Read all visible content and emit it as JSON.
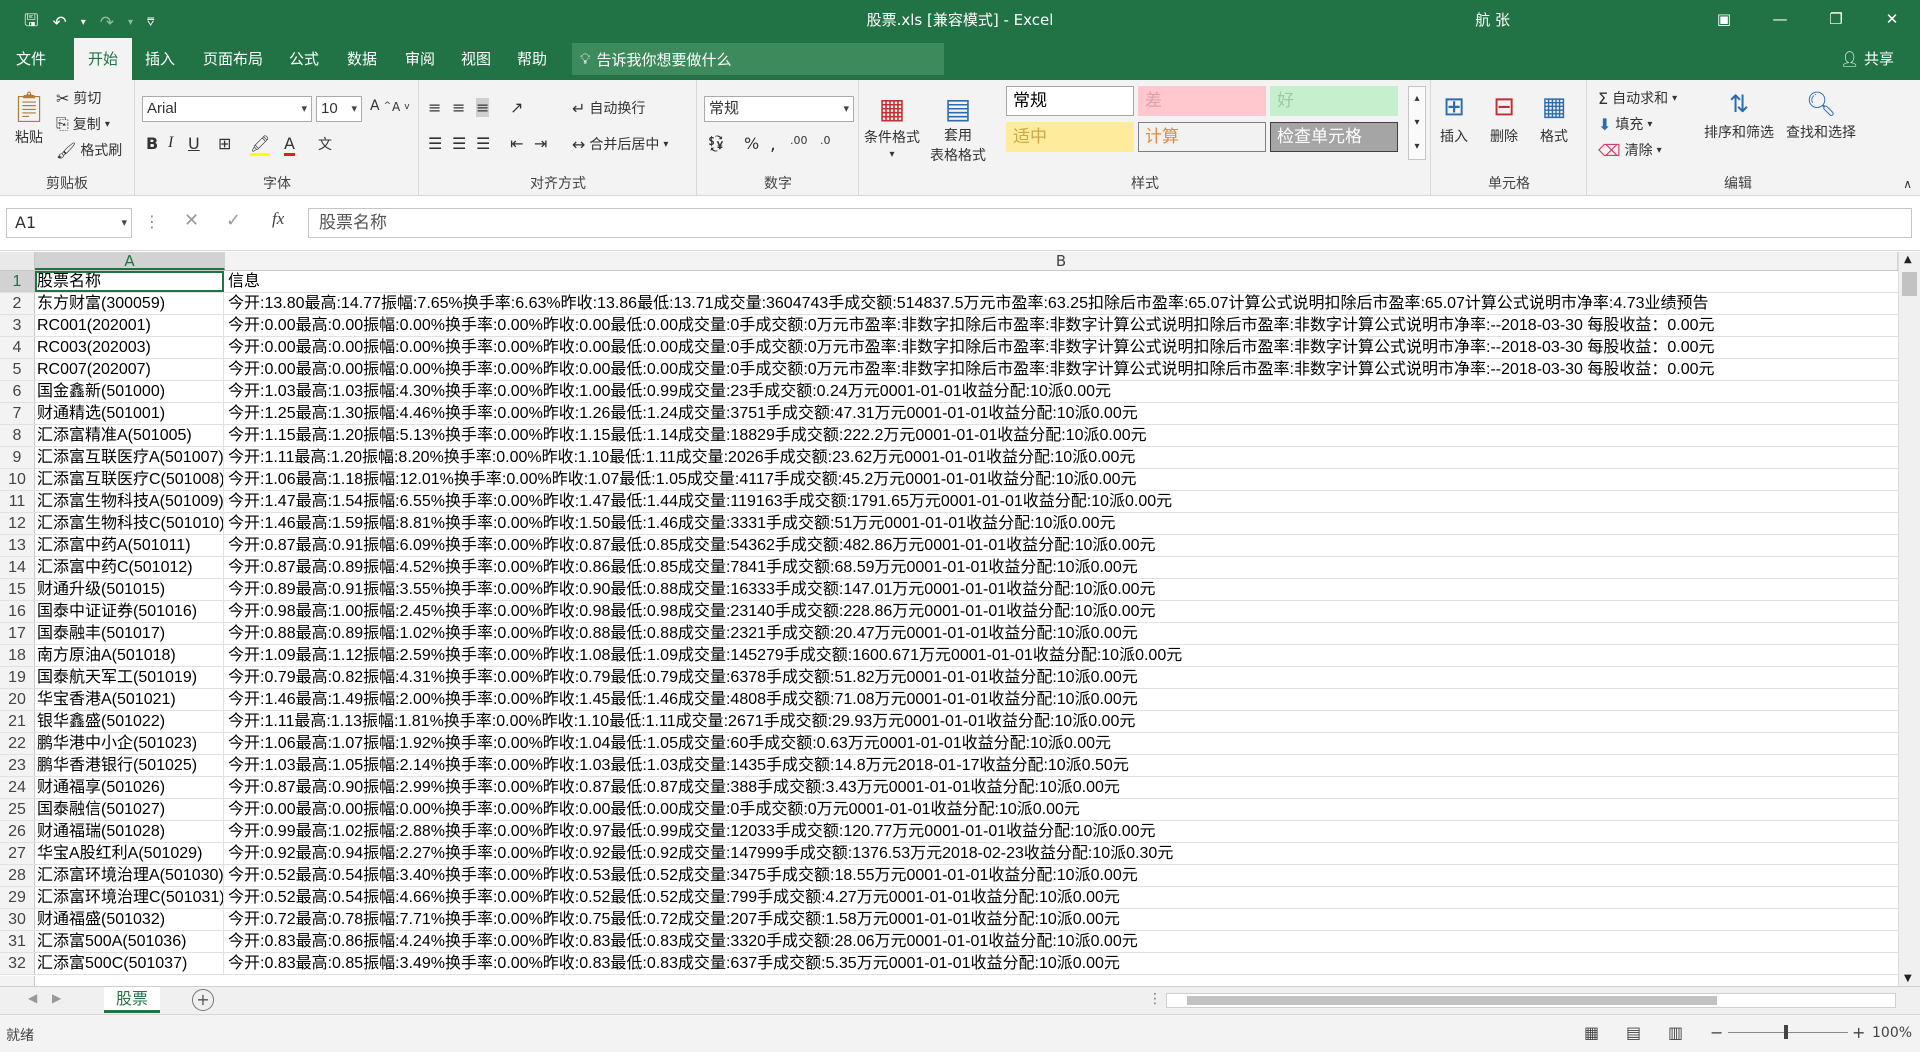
{
  "window": {
    "title": "股票.xls  [兼容模式]  -  Excel",
    "user": "航 张"
  },
  "menu": {
    "tabs": [
      "文件",
      "开始",
      "插入",
      "页面布局",
      "公式",
      "数据",
      "审阅",
      "视图",
      "帮助"
    ],
    "active_tab": "开始",
    "tell_me": "告诉我你想要做什么",
    "share": "共享"
  },
  "ribbon": {
    "clipboard": {
      "paste": "粘贴",
      "cut": "剪切",
      "copy": "复制",
      "format_painter": "格式刷",
      "label": "剪贴板"
    },
    "font": {
      "name": "Arial",
      "size": "10",
      "label": "字体"
    },
    "alignment": {
      "wrap_text": "自动换行",
      "merge_center": "合并后居中",
      "label": "对齐方式"
    },
    "number": {
      "format": "常规",
      "label": "数字"
    },
    "styles": {
      "conditional_formatting": "条件格式",
      "format_as_table_1": "套用",
      "format_as_table_2": "表格格式",
      "cells": [
        {
          "label": "常规",
          "bg": "#ffffff",
          "fg": "#000000",
          "border": "#a6a6a6"
        },
        {
          "label": "差",
          "bg": "#ffc7ce",
          "fg": "#e0a0a8",
          "border": "#ffc7ce"
        },
        {
          "label": "好",
          "bg": "#c6efce",
          "fg": "#9ccaa4",
          "border": "#c6efce"
        },
        {
          "label": "适中",
          "bg": "#ffeb9c",
          "fg": "#c9a84a",
          "border": "#ffeb9c"
        },
        {
          "label": "计算",
          "bg": "#f2f2f2",
          "fg": "#e08a3c",
          "border": "#7f7f7f"
        },
        {
          "label": "检查单元格",
          "bg": "#a5a5a5",
          "fg": "#ffffff",
          "border": "#3f3f3f"
        }
      ],
      "label": "样式"
    },
    "cells_group": {
      "insert": "插入",
      "delete": "删除",
      "format": "格式",
      "label": "单元格"
    },
    "editing": {
      "autosum": "自动求和",
      "fill": "填充",
      "clear": "清除",
      "sort_filter": "排序和筛选",
      "find_select": "查找和选择",
      "label": "编辑"
    }
  },
  "formula_bar": {
    "name_box": "A1",
    "content": "股票名称"
  },
  "columns": [
    "A",
    "B"
  ],
  "rows": [
    {
      "num": "1",
      "a": "股票名称",
      "b": "信息"
    },
    {
      "num": "2",
      "a": "东方财富(300059)",
      "b": "今开:13.80最高:14.77振幅:7.65%换手率:6.63%昨收:13.86最低:13.71成交量:3604743手成交额:514837.5万元市盈率:63.25扣除后市盈率:65.07计算公式说明扣除后市盈率:65.07计算公式说明市净率:4.73业绩预告"
    },
    {
      "num": "3",
      "a": "RC001(202001)",
      "b": "今开:0.00最高:0.00振幅:0.00%换手率:0.00%昨收:0.00最低:0.00成交量:0手成交额:0万元市盈率:非数字扣除后市盈率:非数字计算公式说明扣除后市盈率:非数字计算公式说明市净率:--2018-03-30 每股收益：0.00元"
    },
    {
      "num": "4",
      "a": "RC003(202003)",
      "b": "今开:0.00最高:0.00振幅:0.00%换手率:0.00%昨收:0.00最低:0.00成交量:0手成交额:0万元市盈率:非数字扣除后市盈率:非数字计算公式说明扣除后市盈率:非数字计算公式说明市净率:--2018-03-30 每股收益：0.00元"
    },
    {
      "num": "5",
      "a": "RC007(202007)",
      "b": "今开:0.00最高:0.00振幅:0.00%换手率:0.00%昨收:0.00最低:0.00成交量:0手成交额:0万元市盈率:非数字扣除后市盈率:非数字计算公式说明扣除后市盈率:非数字计算公式说明市净率:--2018-03-30 每股收益：0.00元"
    },
    {
      "num": "6",
      "a": "国金鑫新(501000)",
      "b": "今开:1.03最高:1.03振幅:4.30%换手率:0.00%昨收:1.00最低:0.99成交量:23手成交额:0.24万元0001-01-01收益分配:10派0.00元"
    },
    {
      "num": "7",
      "a": "财通精选(501001)",
      "b": "今开:1.25最高:1.30振幅:4.46%换手率:0.00%昨收:1.26最低:1.24成交量:3751手成交额:47.31万元0001-01-01收益分配:10派0.00元"
    },
    {
      "num": "8",
      "a": "汇添富精准A(501005)",
      "b": "今开:1.15最高:1.20振幅:5.13%换手率:0.00%昨收:1.15最低:1.14成交量:18829手成交额:222.2万元0001-01-01收益分配:10派0.00元"
    },
    {
      "num": "9",
      "a": "汇添富互联医疗A(501007)",
      "b": "今开:1.11最高:1.20振幅:8.20%换手率:0.00%昨收:1.10最低:1.11成交量:2026手成交额:23.62万元0001-01-01收益分配:10派0.00元"
    },
    {
      "num": "10",
      "a": "汇添富互联医疗C(501008)",
      "b": "今开:1.06最高:1.18振幅:12.01%换手率:0.00%昨收:1.07最低:1.05成交量:4117手成交额:45.2万元0001-01-01收益分配:10派0.00元"
    },
    {
      "num": "11",
      "a": "汇添富生物科技A(501009)",
      "b": "今开:1.47最高:1.54振幅:6.55%换手率:0.00%昨收:1.47最低:1.44成交量:119163手成交额:1791.65万元0001-01-01收益分配:10派0.00元"
    },
    {
      "num": "12",
      "a": "汇添富生物科技C(501010)",
      "b": "今开:1.46最高:1.59振幅:8.81%换手率:0.00%昨收:1.50最低:1.46成交量:3331手成交额:51万元0001-01-01收益分配:10派0.00元"
    },
    {
      "num": "13",
      "a": "汇添富中药A(501011)",
      "b": "今开:0.87最高:0.91振幅:6.09%换手率:0.00%昨收:0.87最低:0.85成交量:54362手成交额:482.86万元0001-01-01收益分配:10派0.00元"
    },
    {
      "num": "14",
      "a": "汇添富中药C(501012)",
      "b": "今开:0.87最高:0.89振幅:4.52%换手率:0.00%昨收:0.86最低:0.85成交量:7841手成交额:68.59万元0001-01-01收益分配:10派0.00元"
    },
    {
      "num": "15",
      "a": "财通升级(501015)",
      "b": "今开:0.89最高:0.91振幅:3.55%换手率:0.00%昨收:0.90最低:0.88成交量:16333手成交额:147.01万元0001-01-01收益分配:10派0.00元"
    },
    {
      "num": "16",
      "a": "国泰中证证券(501016)",
      "b": "今开:0.98最高:1.00振幅:2.45%换手率:0.00%昨收:0.98最低:0.98成交量:23140手成交额:228.86万元0001-01-01收益分配:10派0.00元"
    },
    {
      "num": "17",
      "a": "国泰融丰(501017)",
      "b": "今开:0.88最高:0.89振幅:1.02%换手率:0.00%昨收:0.88最低:0.88成交量:2321手成交额:20.47万元0001-01-01收益分配:10派0.00元"
    },
    {
      "num": "18",
      "a": "南方原油A(501018)",
      "b": "今开:1.09最高:1.12振幅:2.59%换手率:0.00%昨收:1.08最低:1.09成交量:145279手成交额:1600.671万元0001-01-01收益分配:10派0.00元"
    },
    {
      "num": "19",
      "a": "国泰航天军工(501019)",
      "b": "今开:0.79最高:0.82振幅:4.31%换手率:0.00%昨收:0.79最低:0.79成交量:6378手成交额:51.82万元0001-01-01收益分配:10派0.00元"
    },
    {
      "num": "20",
      "a": "华宝香港A(501021)",
      "b": "今开:1.46最高:1.49振幅:2.00%换手率:0.00%昨收:1.45最低:1.46成交量:4808手成交额:71.08万元0001-01-01收益分配:10派0.00元"
    },
    {
      "num": "21",
      "a": "银华鑫盛(501022)",
      "b": "今开:1.11最高:1.13振幅:1.81%换手率:0.00%昨收:1.10最低:1.11成交量:2671手成交额:29.93万元0001-01-01收益分配:10派0.00元"
    },
    {
      "num": "22",
      "a": "鹏华港中小企(501023)",
      "b": "今开:1.06最高:1.07振幅:1.92%换手率:0.00%昨收:1.04最低:1.05成交量:60手成交额:0.63万元0001-01-01收益分配:10派0.00元"
    },
    {
      "num": "23",
      "a": "鹏华香港银行(501025)",
      "b": "今开:1.03最高:1.05振幅:2.14%换手率:0.00%昨收:1.03最低:1.03成交量:1435手成交额:14.8万元2018-01-17收益分配:10派0.50元"
    },
    {
      "num": "24",
      "a": "财通福享(501026)",
      "b": "今开:0.87最高:0.90振幅:2.99%换手率:0.00%昨收:0.87最低:0.87成交量:388手成交额:3.43万元0001-01-01收益分配:10派0.00元"
    },
    {
      "num": "25",
      "a": "国泰融信(501027)",
      "b": "今开:0.00最高:0.00振幅:0.00%换手率:0.00%昨收:0.00最低:0.00成交量:0手成交额:0万元0001-01-01收益分配:10派0.00元"
    },
    {
      "num": "26",
      "a": "财通福瑞(501028)",
      "b": "今开:0.99最高:1.02振幅:2.88%换手率:0.00%昨收:0.97最低:0.99成交量:12033手成交额:120.77万元0001-01-01收益分配:10派0.00元"
    },
    {
      "num": "27",
      "a": "华宝A股红利A(501029)",
      "b": "今开:0.92最高:0.94振幅:2.27%换手率:0.00%昨收:0.92最低:0.92成交量:147999手成交额:1376.53万元2018-02-23收益分配:10派0.30元"
    },
    {
      "num": "28",
      "a": "汇添富环境治理A(501030)",
      "b": "今开:0.52最高:0.54振幅:3.40%换手率:0.00%昨收:0.53最低:0.52成交量:3475手成交额:18.55万元0001-01-01收益分配:10派0.00元"
    },
    {
      "num": "29",
      "a": "汇添富环境治理C(501031)",
      "b": "今开:0.52最高:0.54振幅:4.66%换手率:0.00%昨收:0.52最低:0.52成交量:799手成交额:4.27万元0001-01-01收益分配:10派0.00元"
    },
    {
      "num": "30",
      "a": "财通福盛(501032)",
      "b": "今开:0.72最高:0.78振幅:7.71%换手率:0.00%昨收:0.75最低:0.72成交量:207手成交额:1.58万元0001-01-01收益分配:10派0.00元"
    },
    {
      "num": "31",
      "a": "汇添富500A(501036)",
      "b": "今开:0.83最高:0.86振幅:4.24%换手率:0.00%昨收:0.83最低:0.83成交量:3320手成交额:28.06万元0001-01-01收益分配:10派0.00元"
    },
    {
      "num": "32",
      "a": "汇添富500C(501037)",
      "b": "今开:0.83最高:0.85振幅:3.49%换手率:0.00%昨收:0.83最低:0.83成交量:637手成交额:5.35万元0001-01-01收益分配:10派0.00元"
    }
  ],
  "sheet_tab": "股票",
  "status": {
    "ready": "就绪",
    "zoom": "100%"
  }
}
